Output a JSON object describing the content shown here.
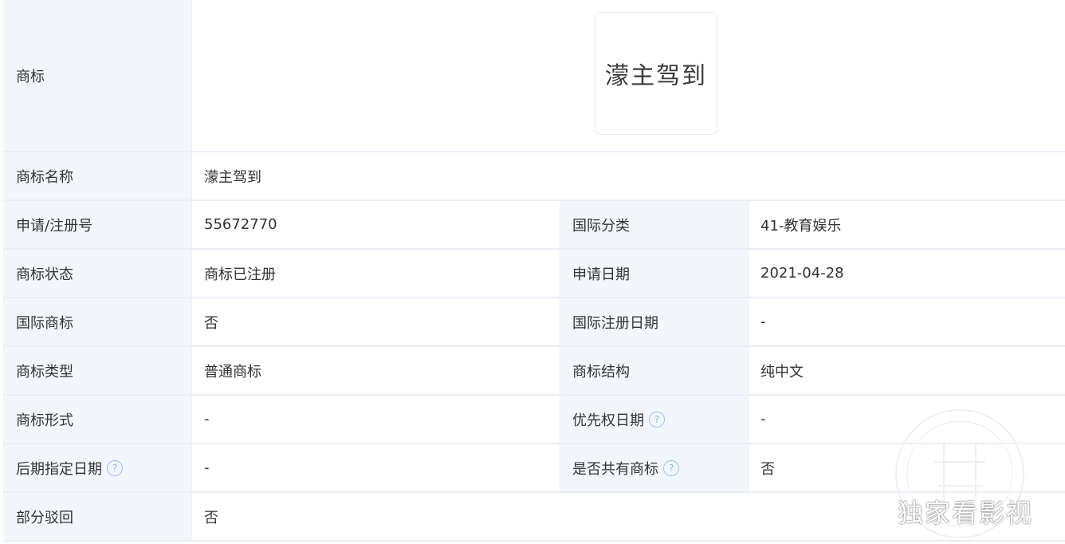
{
  "trademark": {
    "label": "商标",
    "image_text": "濛主驾到"
  },
  "rows_single_top": {
    "label": "商标名称",
    "value": "濛主驾到"
  },
  "rows": [
    {
      "l1": "申请/注册号",
      "v1": "55672770",
      "l2": "国际分类",
      "v2": "41-教育娱乐"
    },
    {
      "l1": "商标状态",
      "v1": "商标已注册",
      "l2": "申请日期",
      "v2": "2021-04-28"
    },
    {
      "l1": "国际商标",
      "v1": "否",
      "l2": "国际注册日期",
      "v2": "-"
    },
    {
      "l1": "商标类型",
      "v1": "普通商标",
      "l2": "商标结构",
      "v2": "纯中文"
    },
    {
      "l1": "商标形式",
      "v1": "-",
      "l2": "优先权日期",
      "v2": "-"
    },
    {
      "l1": "后期指定日期",
      "v1": "-",
      "l2": "是否共有商标",
      "v2": "否"
    }
  ],
  "rows_single_bottom": {
    "label": "部分驳回",
    "value": "否"
  },
  "help_glyph": "?",
  "watermark": {
    "text": "独家看影视"
  },
  "colors": {
    "label_bg": "#f2f6fb",
    "border": "#e9eef4",
    "help_icon": "#9ec2ea"
  }
}
